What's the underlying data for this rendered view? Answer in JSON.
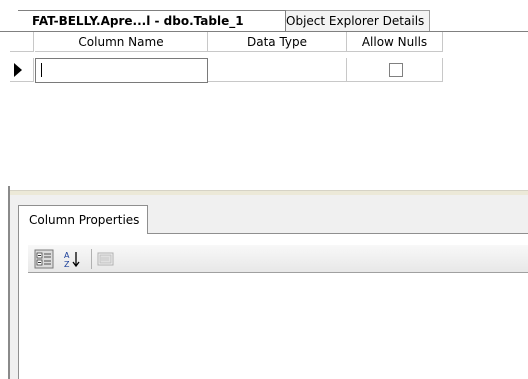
{
  "tabs": [
    {
      "label": "FAT-BELLY.Apre...l - dbo.Table_1",
      "active": true
    },
    {
      "label": "Object Explorer Details",
      "active": false
    }
  ],
  "grid": {
    "columns": [
      "Column Name",
      "Data Type",
      "Allow Nulls"
    ],
    "rows": [
      {
        "column_name": "",
        "data_type": "",
        "allow_nulls": false
      }
    ]
  },
  "properties": {
    "tab_label": "Column Properties",
    "toolbar": {
      "categorized_icon": "categorized-view-icon",
      "alphabetical_icon": "sort-alphabetical-icon",
      "property_pages_icon": "property-pages-icon"
    }
  },
  "colors": {
    "border": "#808080",
    "panel_bg": "#f0f0f0",
    "toolbar_bg": "#efefef"
  }
}
